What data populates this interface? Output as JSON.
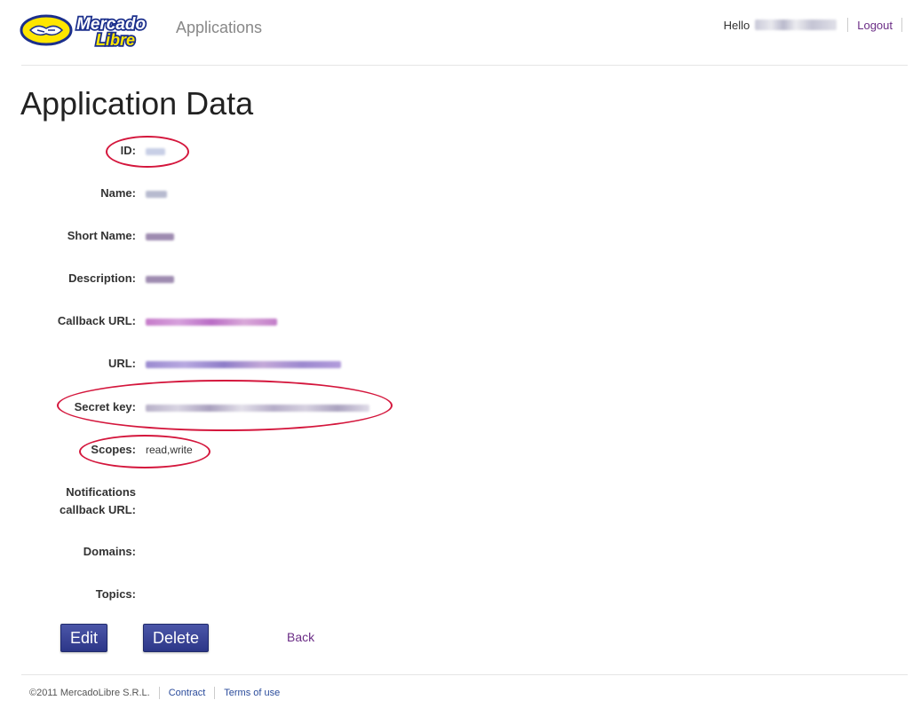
{
  "header": {
    "brand_line1": "Mercado",
    "brand_line2": "Libre",
    "app_title": "Applications",
    "greeting": "Hello",
    "logout_label": "Logout"
  },
  "page_title": "Application Data",
  "fields": {
    "id": {
      "label": "ID:"
    },
    "name": {
      "label": "Name:"
    },
    "short_name": {
      "label": "Short Name:"
    },
    "description": {
      "label": "Description:"
    },
    "callback_url": {
      "label": "Callback URL:"
    },
    "url": {
      "label": "URL:"
    },
    "secret_key": {
      "label": "Secret key:"
    },
    "scopes": {
      "label": "Scopes:",
      "value": "read,write"
    },
    "notifications_url": {
      "label_line1": "Notifications",
      "label_line2": "callback URL:"
    },
    "domains": {
      "label": "Domains:"
    },
    "topics": {
      "label": "Topics:"
    }
  },
  "actions": {
    "edit_label": "Edit",
    "delete_label": "Delete",
    "back_label": "Back"
  },
  "footer": {
    "copyright": "©2011 MercadoLibre S.R.L.",
    "contract_label": "Contract",
    "terms_label": "Terms of use"
  },
  "colors": {
    "accent_button": "#2c3688",
    "link_purple": "#6b2d86",
    "link_blue": "#2a4b9b",
    "highlight_oval": "#d4163c",
    "logo_yellow": "#ffe600"
  }
}
